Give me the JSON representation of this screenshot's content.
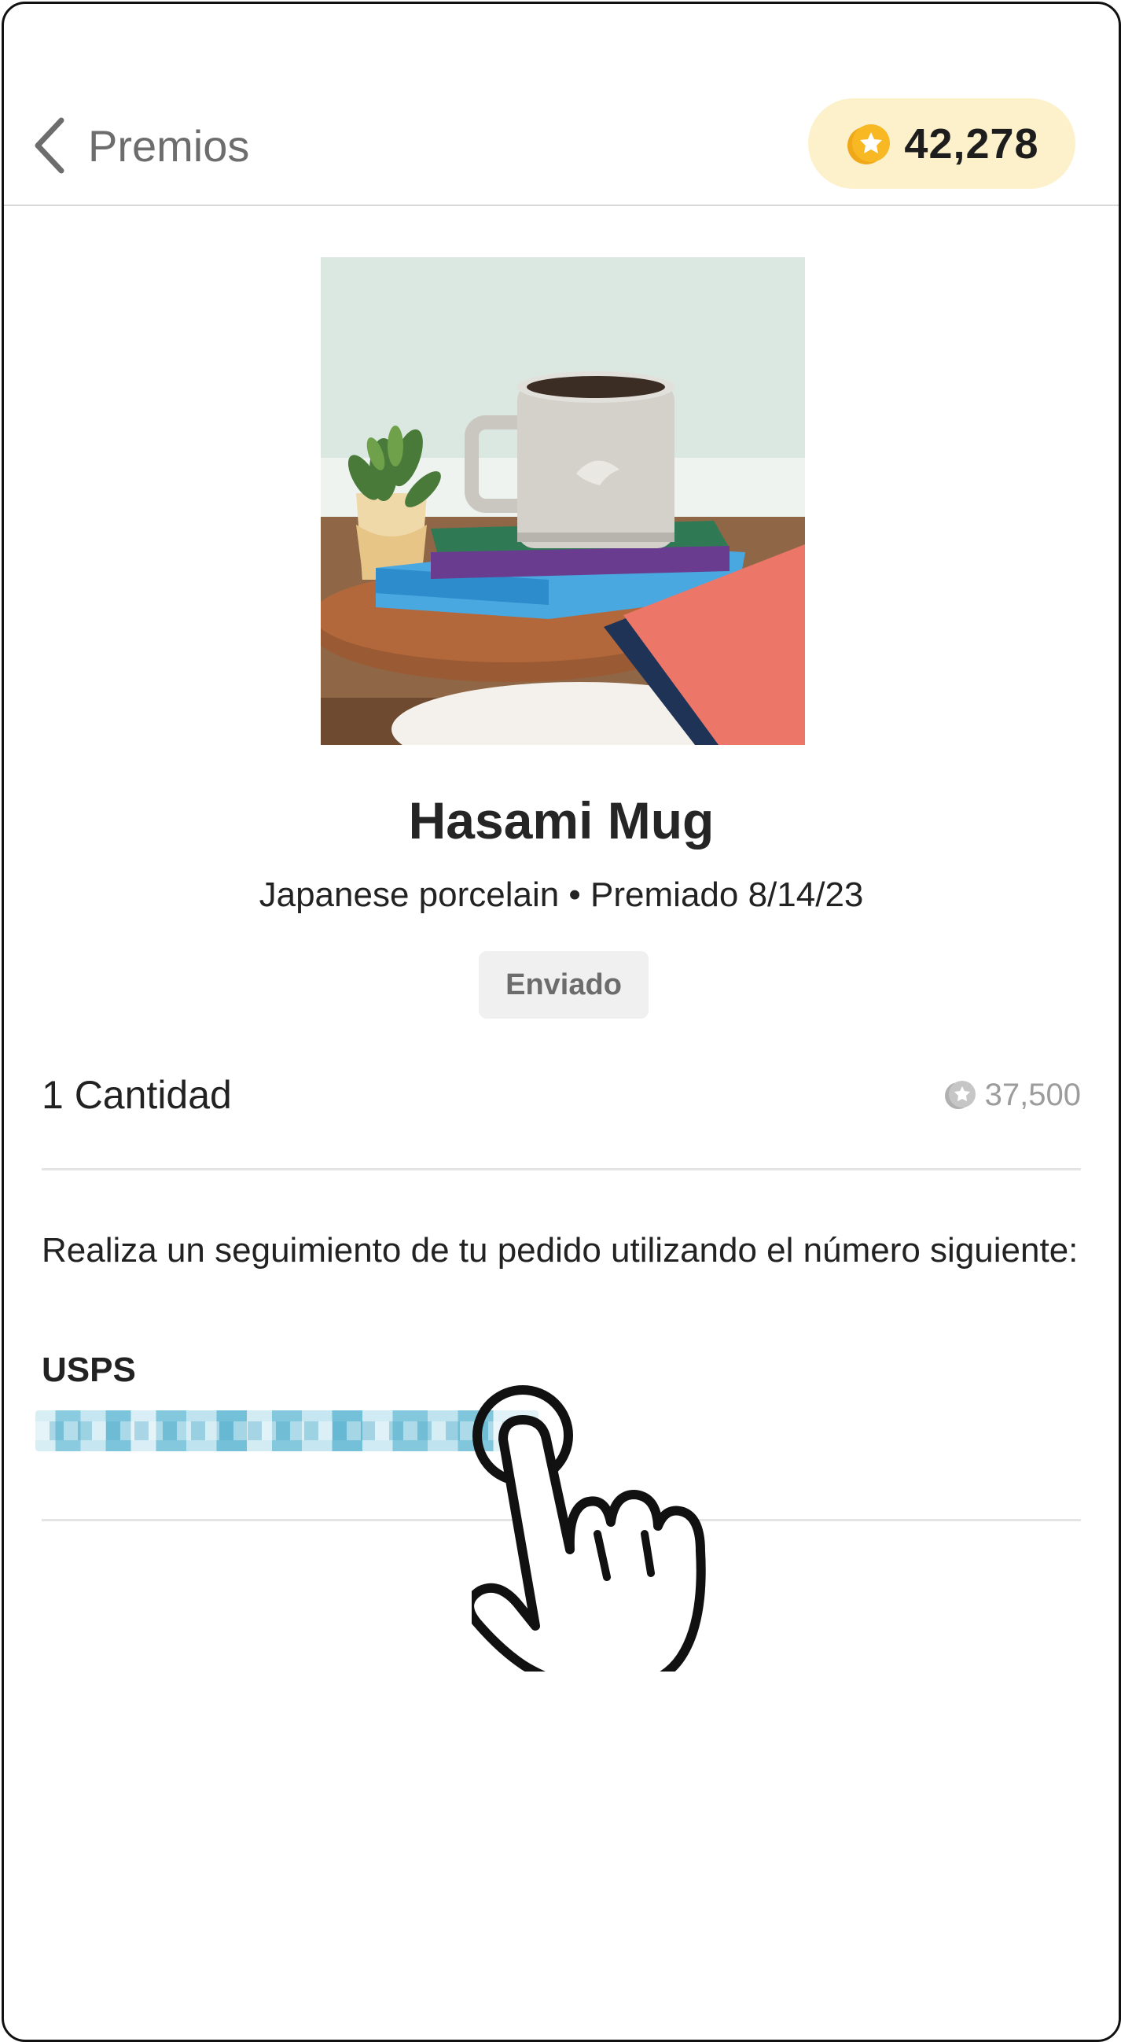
{
  "header": {
    "back_label": "Premios",
    "points": "42,278"
  },
  "product": {
    "name": "Hasami Mug",
    "subtitle": "Japanese porcelain • Premiado 8/14/23",
    "status": "Enviado",
    "image_alt": "mug-on-books-photo"
  },
  "order": {
    "quantity_label": "1 Cantidad",
    "cost": "37,500"
  },
  "tracking": {
    "instructions": "Realiza un seguimiento de tu pedido utilizando el número siguiente:",
    "carrier": "USPS",
    "number_redacted": "pixelated-tracking-number"
  },
  "colors": {
    "points_pill_bg": "#fdf1cc",
    "coin": "#f5b21c",
    "status_badge_bg": "#f0f0f0",
    "tracking_link": "#6fbfd8"
  },
  "icons": {
    "back": "chevron-left-icon",
    "coin": "coin-icon",
    "pointer": "pointing-hand-icon"
  }
}
